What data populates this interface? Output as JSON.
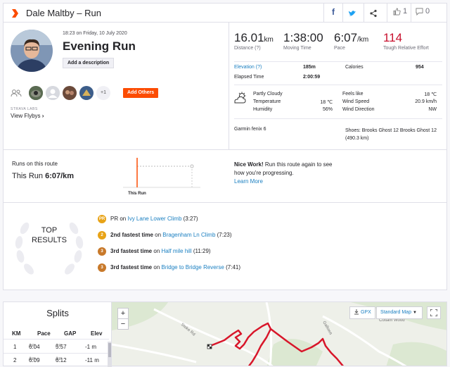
{
  "header": {
    "title": "Dale Maltby – Run",
    "kudos_count": "1",
    "comments_count": "0"
  },
  "activity": {
    "datetime": "18:23 on Friday, 10 July 2020",
    "name": "Evening Run",
    "add_description": "Add a description",
    "add_others": "Add Others",
    "extra_athletes": "+1",
    "labs_label": "STRAVA LABS",
    "view_flybys": "View Flybys"
  },
  "stats": {
    "distance_value": "16.01",
    "distance_unit": "km",
    "distance_label": "Distance (?)",
    "moving_time_value": "1:38:00",
    "moving_time_label": "Moving Time",
    "pace_value": "6:07",
    "pace_unit": "/km",
    "pace_label": "Pace",
    "relative_effort_value": "114",
    "relative_effort_label": "Tough Relative Effort",
    "elevation_label": "Elevation (?)",
    "elevation_value": "185m",
    "calories_label": "Calories",
    "calories_value": "954",
    "elapsed_label": "Elapsed Time",
    "elapsed_value": "2:00:59"
  },
  "weather": {
    "condition": "Partly Cloudy",
    "temperature_label": "Temperature",
    "temperature_value": "18 ℃",
    "humidity_label": "Humidity",
    "humidity_value": "56%",
    "feels_like_label": "Feels like",
    "feels_like_value": "18 ℃",
    "wind_speed_label": "Wind Speed",
    "wind_speed_value": "20.9 km/h",
    "wind_direction_label": "Wind Direction",
    "wind_direction_value": "NW"
  },
  "gear": {
    "device": "Garmin fenix 6",
    "shoes": "Shoes: Brooks Ghost 12 Brooks Ghost 12 (490.3 km)"
  },
  "route": {
    "title": "Runs on this route",
    "this_run_label": "This Run",
    "this_run_pace": "6:07/km",
    "chart_label": "This Run",
    "nice_bold": "Nice Work!",
    "nice_text": " Run this route again to see how you're progressing.",
    "learn_more": "Learn More"
  },
  "top_results": {
    "title_line1": "TOP",
    "title_line2": "RESULTS",
    "items": [
      {
        "medal": "PR",
        "medal_color": "#e8a317",
        "rank": "PR",
        "segment": "Ivy Lane Lower Climb",
        "time": "(3:27)"
      },
      {
        "medal": "2",
        "medal_color": "#e8a317",
        "rank": "2nd fastest time",
        "segment": "Bragenham Ln Climb",
        "time": "(7:23)"
      },
      {
        "medal": "3",
        "medal_color": "#c8792a",
        "rank": "3rd fastest time",
        "segment": "Half mile hill",
        "time": "(11:29)"
      },
      {
        "medal": "3",
        "medal_color": "#c8792a",
        "rank": "3rd fastest time",
        "segment": "Bridge to Bridge Reverse",
        "time": "(7:41)"
      }
    ]
  },
  "splits": {
    "title": "Splits",
    "headers": [
      "KM",
      "Pace",
      "GAP",
      "Elev"
    ],
    "rows": [
      {
        "km": "1",
        "pace": "6:04",
        "pace_unit": "/km",
        "gap": "5:57",
        "gap_unit": "/km",
        "elev": "-1 m"
      },
      {
        "km": "2",
        "pace": "6:09",
        "pace_unit": "/km",
        "gap": "6:12",
        "gap_unit": "/km",
        "elev": "-11 m"
      }
    ]
  },
  "map": {
    "gpx_label": "GPX",
    "map_type": "Standard Map",
    "zoom_in": "+",
    "zoom_out": "−",
    "road_1": "Stoke Rd",
    "road_2": "Gallows",
    "place": "Cottam Wood"
  },
  "colors": {
    "brand": "#fc4c02",
    "link": "#1a7fc1",
    "route": "#d8162a"
  }
}
